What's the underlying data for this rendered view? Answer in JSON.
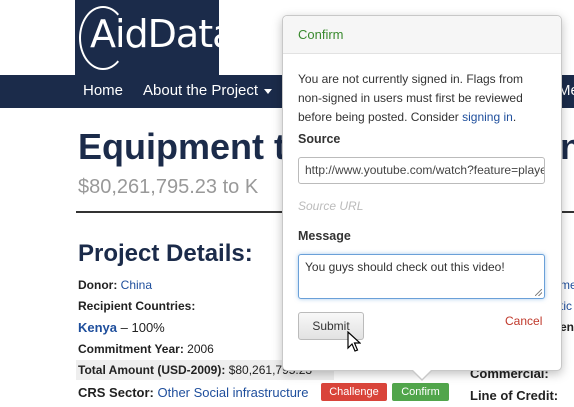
{
  "logo": {
    "text": "AidData"
  },
  "nav": {
    "home": "Home",
    "about": "About the Project",
    "overflow": "Me"
  },
  "project": {
    "title": "Equipment t",
    "title_tail": "na",
    "amount": "$80,261,795.23 to K"
  },
  "details": {
    "heading": "Project Details:",
    "donor_label": "Donor:",
    "donor_value": "China",
    "recipient_label": "Recipient Countries:",
    "recipient_country": "Kenya",
    "recipient_share": " – 100%",
    "commitment_label": "Commitment Year:",
    "commitment_value": "2006",
    "total_label": "Total Amount (USD-2009):",
    "total_value": "$80,261,795.23",
    "crs_label": "CRS Sector:",
    "crs_value": "Other Social infrastructure"
  },
  "right_column": {
    "commercial_label": "Commercial:",
    "line_of_credit_label": "Line of Credit:",
    "frag1": "me",
    "frag2": "tic",
    "frag3": "en"
  },
  "flag_buttons": {
    "challenge": "Challenge",
    "confirm": "Confirm"
  },
  "popover": {
    "title": "Confirm",
    "message_before_link": "You are not currently signed in. Flags from non-signed in users must first be reviewed before being posted. Consider ",
    "signin_link": "signing in",
    "message_after_link": ".",
    "source_label": "Source",
    "source_value": "http://www.youtube.com/watch?feature=player",
    "source_hint": "Source URL",
    "message_label": "Message",
    "message_value": "You guys should check out this video!",
    "submit_label": "Submit",
    "cancel_label": "Cancel"
  },
  "colors": {
    "navy": "#1b2b4a",
    "link": "#1e4e9c",
    "challenge": "#d9443a",
    "confirm": "#51a54b",
    "popover_title": "#3a8a2f",
    "cancel": "#c0392b"
  }
}
